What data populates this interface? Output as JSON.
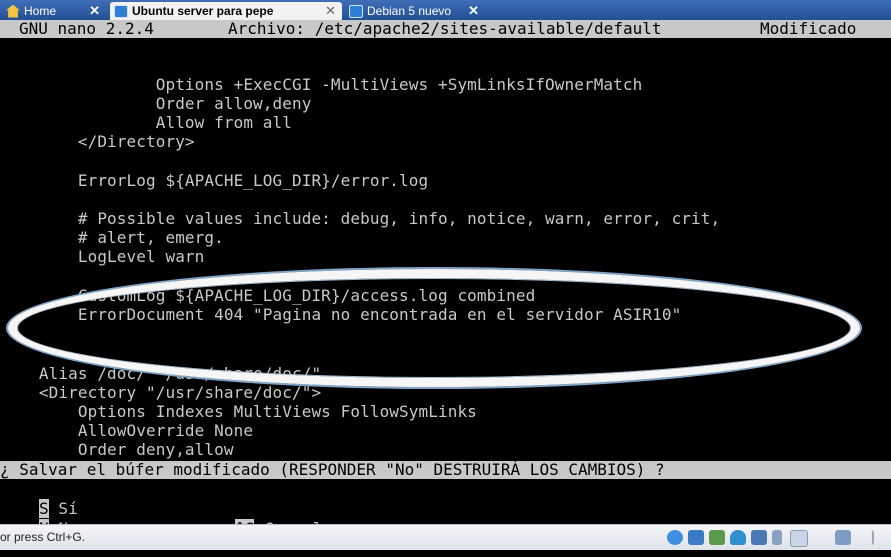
{
  "tabs": [
    {
      "label": "Home",
      "icon": "home-icon"
    },
    {
      "label": "Ubuntu server para pepe",
      "icon": "vm-icon",
      "active": true
    },
    {
      "label": "Debian 5 nuevo",
      "icon": "vm-icon"
    }
  ],
  "nano": {
    "version": "GNU nano 2.2.4",
    "file": "Archivo: /etc/apache2/sites-available/default",
    "status": "Modificado"
  },
  "editor_lines": [
    "                Options +ExecCGI -MultiViews +SymLinksIfOwnerMatch",
    "                Order allow,deny",
    "                Allow from all",
    "        </Directory>",
    "",
    "        ErrorLog ${APACHE_LOG_DIR}/error.log",
    "",
    "        # Possible values include: debug, info, notice, warn, error, crit,",
    "        # alert, emerg.",
    "        LogLevel warn",
    "",
    "        CustomLog ${APACHE_LOG_DIR}/access.log combined",
    "        ErrorDocument 404 \"Pagina no encontrada en el servidor ASIR10\"",
    "",
    "",
    "    Alias /doc/ \"/usr/share/doc/\"",
    "    <Directory \"/usr/share/doc/\">",
    "        Options Indexes MultiViews FollowSymLinks",
    "        AllowOverride None",
    "        Order deny,allow"
  ],
  "prompt": "¿ Salvar el búfer modificado (RESPONDER \"No\" DESTRUIRÁ LOS CAMBIOS) ? ",
  "options": {
    "yes_key": "S",
    "yes_label": "Sí",
    "no_key": "N",
    "no_label": "No",
    "cancel_key": "^C",
    "cancel_label": "Cancelar"
  },
  "statusbar": {
    "text": "or press Ctrl+G."
  }
}
